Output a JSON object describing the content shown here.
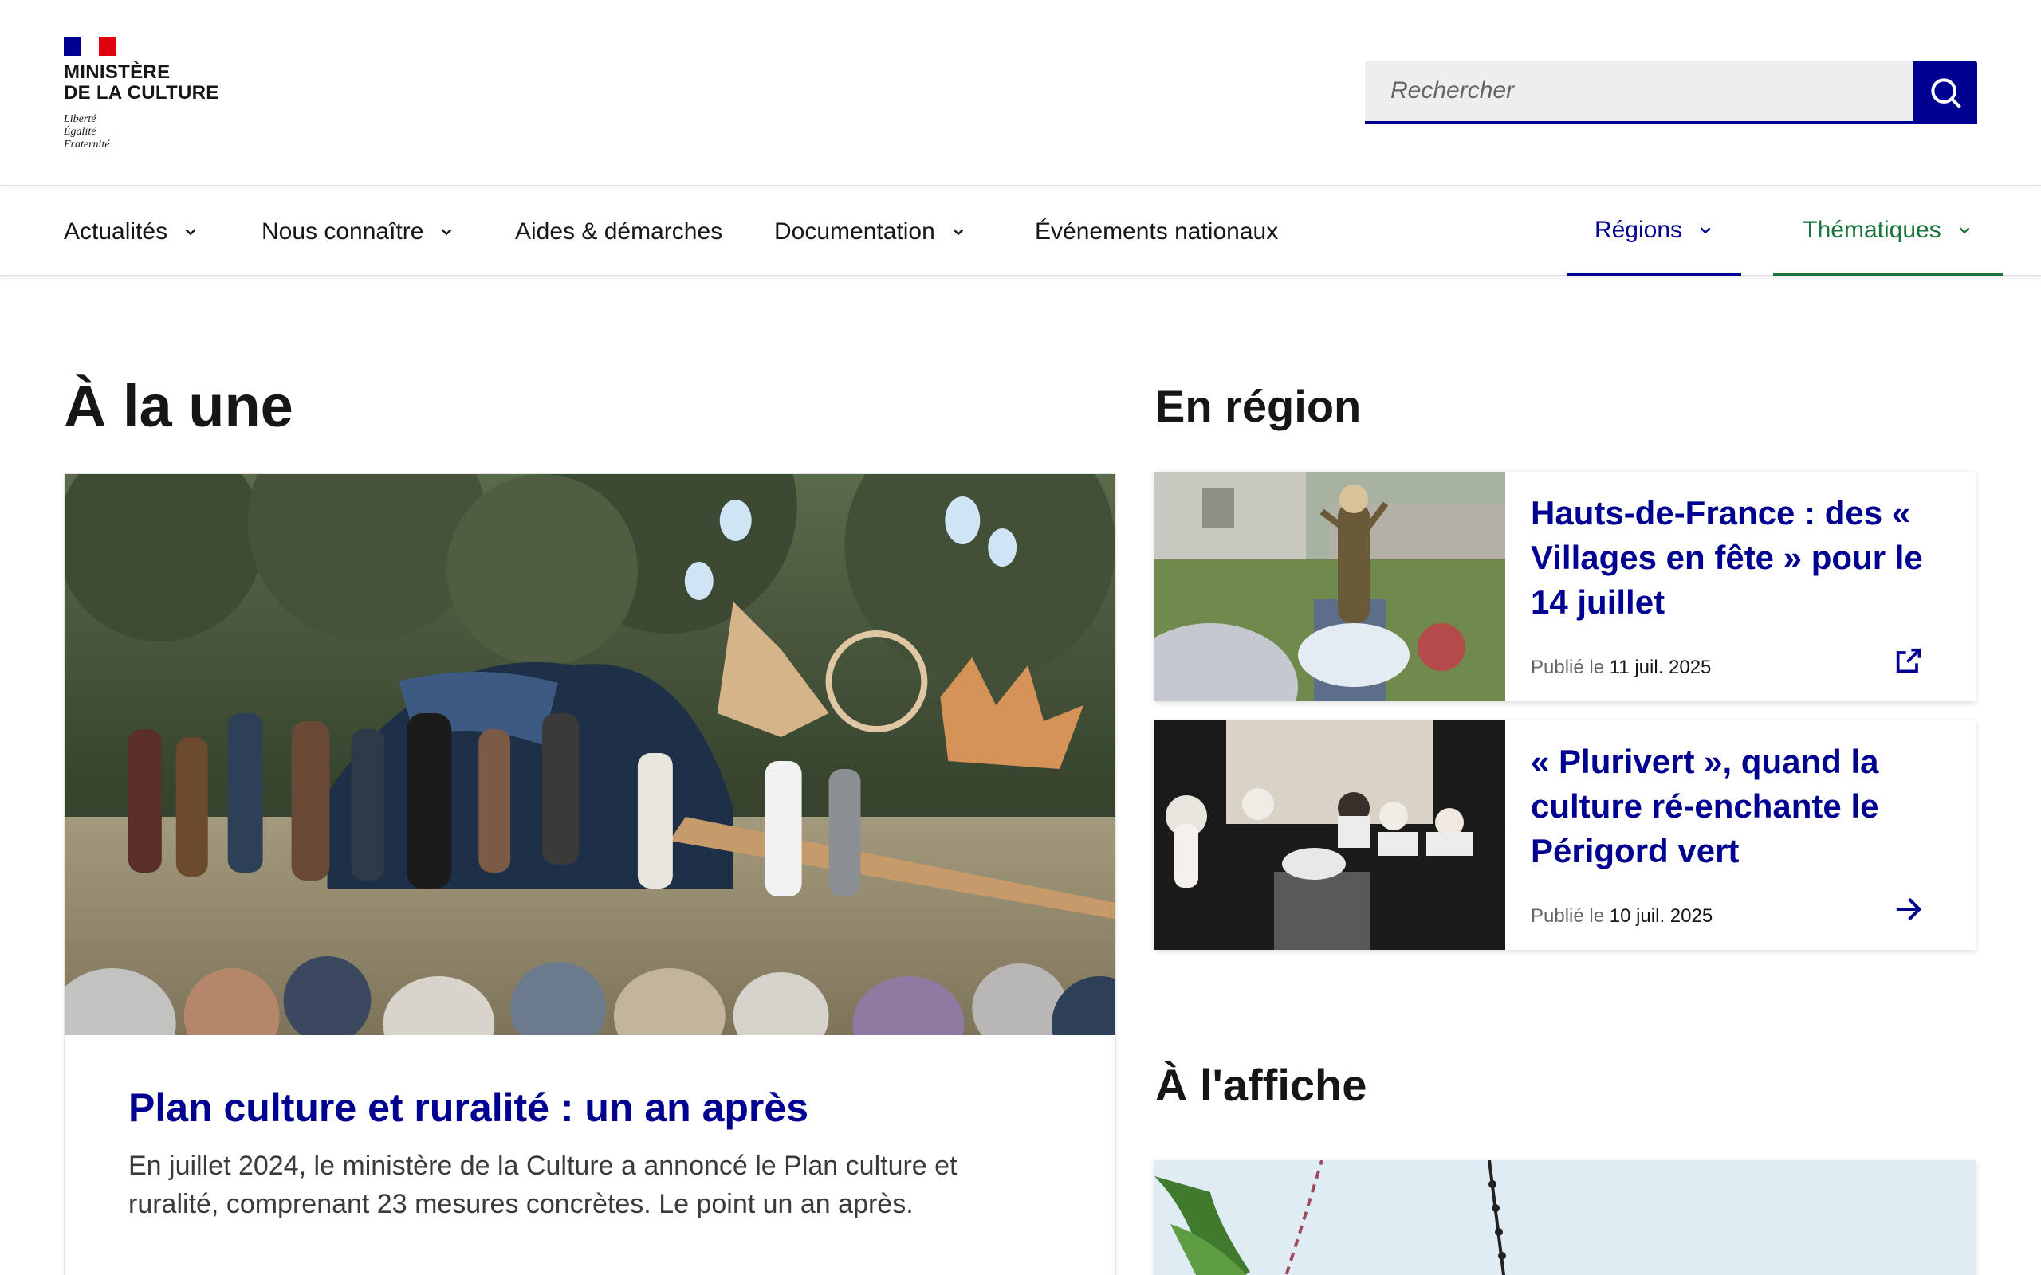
{
  "header": {
    "logo": {
      "name": "Ministère\nde la Culture",
      "motto": "Liberté\nÉgalité\nFraternité"
    },
    "search": {
      "placeholder": "Rechercher",
      "icon": "search-icon"
    }
  },
  "nav": {
    "items": [
      {
        "label": "Actualités",
        "has_dropdown": true
      },
      {
        "label": "Nous connaître",
        "has_dropdown": true
      },
      {
        "label": "Aides & démarches",
        "has_dropdown": false
      },
      {
        "label": "Documentation",
        "has_dropdown": true
      },
      {
        "label": "Événements nationaux",
        "has_dropdown": false
      }
    ],
    "regions_label": "Régions",
    "themes_label": "Thématiques"
  },
  "une": {
    "heading": "À la une",
    "title": "Plan culture et ruralité : un an après",
    "description": "En juillet 2024, le ministère de la Culture a annoncé le Plan culture et ruralité, comprenant 23 mesures concrètes. Le point un an après."
  },
  "region": {
    "heading": "En région",
    "cards": [
      {
        "title": "Hauts-de-France : des « Villages en fête » pour le 14 juillet",
        "date_prefix": "Publié le",
        "date": "11 juil. 2025",
        "icon": "external-link-icon"
      },
      {
        "title": "« Plurivert », quand la culture ré-enchante le Périgord vert",
        "date_prefix": "Publié le",
        "date": "10 juil. 2025",
        "icon": "arrow-right-icon"
      }
    ]
  },
  "affiche": {
    "heading": "À l'affiche"
  },
  "colors": {
    "brand_blue": "#000091",
    "brand_red": "#e1000f",
    "theme_green": "#18753c"
  }
}
